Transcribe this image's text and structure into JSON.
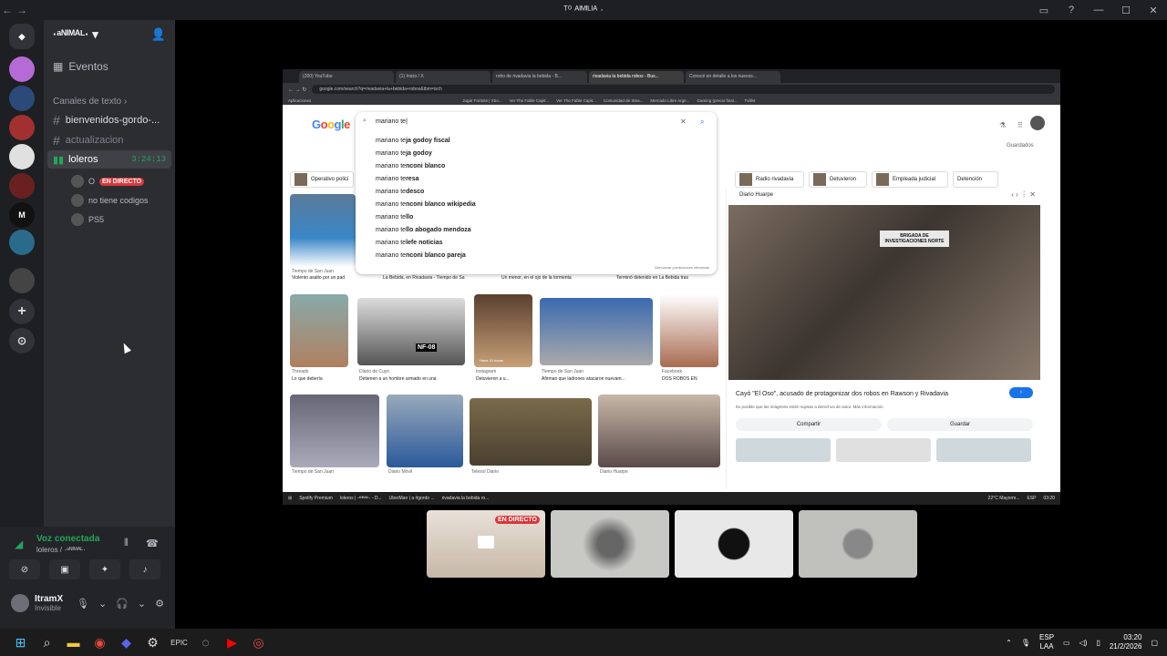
{
  "window": {
    "title": "ᵀ⁰ ᴬᴵᴹᴵᴸᴵᴬ ·"
  },
  "server": {
    "name": "·ᵃᴺᴵᴹᴬᴸ· ▾"
  },
  "sidebar": {
    "events": "Eventos",
    "category": "Canales de texto",
    "channels": [
      "bienvenidos-gordo-...",
      "actualizacion"
    ],
    "voice_channel": {
      "name": "loleros",
      "timer": "3:24:13"
    },
    "voice_users": [
      {
        "name": "O",
        "badge": "EN DIRECTO"
      },
      {
        "name": "no tiene codigos"
      },
      {
        "name": "PS5"
      }
    ]
  },
  "voice_panel": {
    "status": "Voz conectada",
    "channel": "loleros / ·ᵃᴺᴵᴹᴬᴸ·"
  },
  "user": {
    "name": "ItramX",
    "status": "Invisible"
  },
  "browser": {
    "tabs": [
      "(200) YouTube",
      "(1) Inicio / X",
      "robo de rivadavia la bebida - B...",
      "rivadavia la bebida robos - Bus...",
      "Conocé en detalle a los nuevos..."
    ],
    "url": "google.com/search?q=rivadavia+la+bebida+robos&tbm=isch",
    "bookmarks": [
      "Aplicaciones",
      "Jugar Fortnite | Xbo...",
      "Ver The Fable Capit...",
      "Ver The Fable Capit...",
      "Comunidad de Stea...",
      "Mercado Libre Arge...",
      "Gaming (precio final...",
      "Tvillet"
    ],
    "search_query": "mariano te|",
    "suggestions": [
      {
        "prefix": "mariano te",
        "rest": "ja godoy fiscal"
      },
      {
        "prefix": "mariano te",
        "rest": "ja godoy"
      },
      {
        "prefix": "mariano te",
        "rest": "nconi blanco"
      },
      {
        "prefix": "mariano te",
        "rest": "resa"
      },
      {
        "prefix": "mariano te",
        "rest": "desco"
      },
      {
        "prefix": "mariano te",
        "rest": "nconi blanco wikipedia"
      },
      {
        "prefix": "mariano te",
        "rest": "llo"
      },
      {
        "prefix": "mariano te",
        "rest": "llo abogado mendoza"
      },
      {
        "prefix": "mariano te",
        "rest": "lefe noticias"
      },
      {
        "prefix": "mariano te",
        "rest": "nconi blanco pareja"
      }
    ],
    "report": "Denunciar predicciones ofensivas",
    "saved": "Guardados",
    "chips": [
      "Operativo polici",
      "Radio rivadavia",
      "Detuvieron",
      "Empleada judicial",
      "Detención"
    ],
    "captions": [
      {
        "src": "Tiempo de San Juan",
        "title": "Violento asalto por un pad"
      },
      {
        "src": "",
        "title": "La Bebida, en Rivadavia - Tiempo de Sa"
      },
      {
        "src": "",
        "title": "Un menor, en el ojo de la tormenta"
      },
      {
        "src": "",
        "title": "Terminó detenido en La Bebida tras"
      },
      {
        "src": "Threads",
        "title": "Lo que debería"
      },
      {
        "src": "Diario de Cuyo",
        "title": "Detienen a un hombre armado en una"
      },
      {
        "src": "Instagram",
        "title": "Detuvieron a u..."
      },
      {
        "src": "Tiempo de San Juan",
        "title": "Afirman que ladrones atacaron nuevam..."
      },
      {
        "src": "Facebook",
        "title": "DOS ROBOS EN"
      },
      {
        "src": "Tiempo de San Juan",
        "title": ""
      },
      {
        "src": "Diario Móvil",
        "title": ""
      },
      {
        "src": "Telesol Diario",
        "title": ""
      },
      {
        "src": "Diario Huarpe",
        "title": ""
      }
    ],
    "nf_label": "NF-08",
    "hace": "Hace 10 horas",
    "panel": {
      "source": "Diario Huarpe",
      "title": "Cayó \"El Oso\", acusado de protagonizar dos robos en Rawson y Rivadavia",
      "note": "Es posible que las imágenes estén sujetas a derechos de autor. Más información",
      "share": "Compartir",
      "save": "Guardar",
      "sign": "BRIGADA DE INVESTIGACIONES NORTE"
    },
    "win_taskbar": [
      "Spotify Premium",
      "loleros | ·ᵃᴺᴵᴹᴬᴸ· - D...",
      "UberMan | a #gordo ...",
      "rivadavia la bebida ro..."
    ],
    "win_tray": {
      "temp": "22°C  Mayorm...",
      "lang": "ESP",
      "time": "03:20"
    }
  },
  "tiles": [
    {
      "badge": "EN DIRECTO"
    },
    {},
    {},
    {}
  ],
  "taskbar": {
    "lang": "ESP\nLAA",
    "time": "03:20",
    "date": "21/2/2026"
  },
  "colors": {
    "discord_green": "#23a559",
    "live_red": "#da373c",
    "blurple": "#5865f2"
  }
}
